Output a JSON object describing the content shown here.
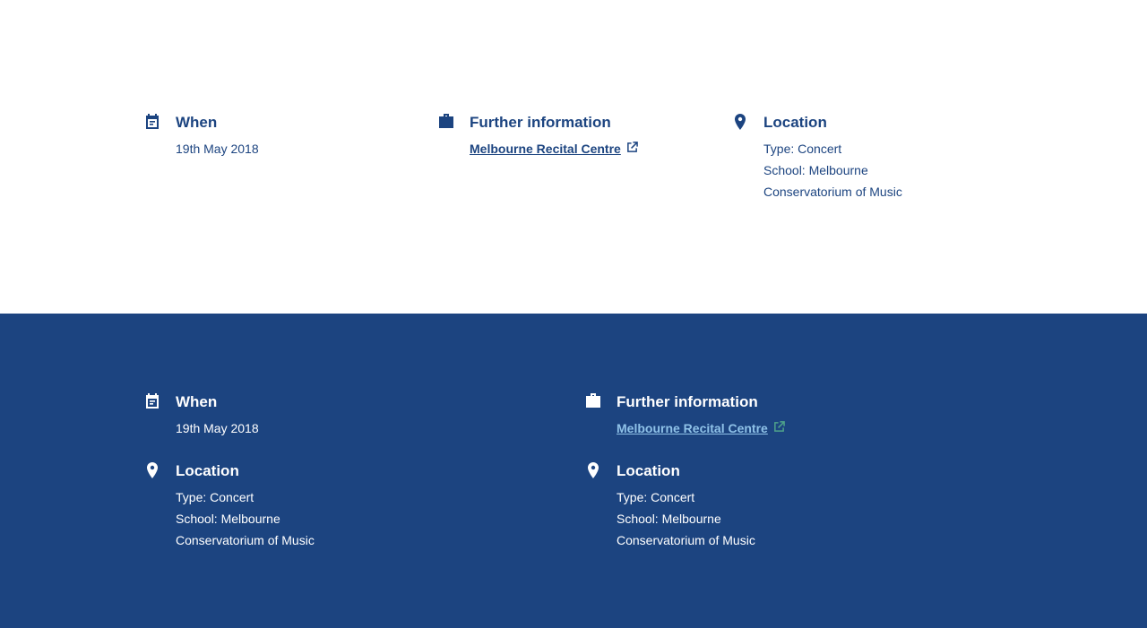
{
  "light_section": {
    "when": {
      "title": "When",
      "date": "19th May 2018"
    },
    "further": {
      "title": "Further information",
      "link_text": "Melbourne Recital Centre"
    },
    "location": {
      "title": "Location",
      "type": "Type: Concert",
      "school_line1": "School: Melbourne",
      "school_line2": "Conservatorium of Music"
    }
  },
  "dark_section": {
    "when": {
      "title": "When",
      "date": "19th May 2018"
    },
    "further": {
      "title": "Further information",
      "link_text": "Melbourne Recital Centre"
    },
    "location_left": {
      "title": "Location",
      "type": "Type: Concert",
      "school_line1": "School: Melbourne",
      "school_line2": "Conservatorium of Music"
    },
    "location_right": {
      "title": "Location",
      "type": "Type: Concert",
      "school_line1": "School: Melbourne",
      "school_line2": "Conservatorium of Music"
    }
  },
  "colors": {
    "brand_navy": "#1c4480",
    "link_light_blue": "#8fc2e8",
    "white": "#ffffff"
  },
  "icons": [
    "calendar-icon",
    "briefcase-icon",
    "map-pin-icon",
    "external-link-icon"
  ]
}
